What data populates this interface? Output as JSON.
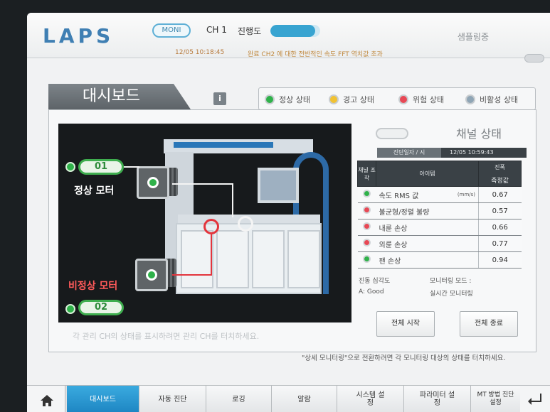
{
  "header": {
    "logo": "LAPS",
    "mode_badge": "MONI",
    "channel": "CH 1",
    "progress_label": "진행도",
    "progress_fraction": 0.9,
    "status": "샘플링중",
    "timestamp": "12/05  10:18:45",
    "notice": "완료 CH2 에 대한 전반적인 속도 FFT 역치값 초과"
  },
  "dashboard": {
    "title": "대시보드",
    "info_icon": "i"
  },
  "legend": [
    {
      "label": "정상 상태",
      "color": "#2fb24a"
    },
    {
      "label": "경고 상태",
      "color": "#f1c232"
    },
    {
      "label": "위험 상태",
      "color": "#e84855"
    },
    {
      "label": "비활성 상태",
      "color": "#8fa5b5"
    }
  ],
  "photo": {
    "ch1_label": "01",
    "ch2_label": "02",
    "normal_motor": "정상 모터",
    "abnormal_motor": "비정상 모터",
    "hint": "각 관리 CH의 상태를 표시하려면 관리 CH를 터치하세요."
  },
  "channel": {
    "title": "채널 상태",
    "diag_label": "진단일자 / 시",
    "diag_value": "12/05  10:59:43",
    "col_channel": "채널 조작",
    "col_item": "아이템",
    "col_value_top": "진폭",
    "col_value_bottom": "측정값",
    "rows": [
      {
        "item": "속도 RMS 값",
        "unit": "(mm/s)",
        "value": "0.67",
        "status": "green"
      },
      {
        "item": "불균형/정렬 불량",
        "unit": "",
        "value": "0.57",
        "status": "red"
      },
      {
        "item": "내륜 손상",
        "unit": "",
        "value": "0.66",
        "status": "red"
      },
      {
        "item": "외륜 손상",
        "unit": "",
        "value": "0.77",
        "status": "red"
      },
      {
        "item": "팬 손상",
        "unit": "",
        "value": "0.94",
        "status": "green"
      }
    ],
    "severity_label": "진동 심각도",
    "severity_value": "A: Good",
    "monitor_label": "모니터링 모드 :",
    "monitor_value": "실시간 모니터링",
    "start_all": "전체 시작",
    "stop_all": "전체 종료"
  },
  "bottom_hint": "\"상세 모니터링\"으로 전환하려면 각 모니터링 대상의 상태를 터치하세요.",
  "nav": {
    "home_icon": "home-icon",
    "items": [
      {
        "label": "대시보드",
        "active": true
      },
      {
        "label": "자동 진단",
        "active": false
      },
      {
        "label": "로깅",
        "active": false
      },
      {
        "label": "알람",
        "active": false
      },
      {
        "label": "시스템 설정",
        "active": false
      },
      {
        "label": "파라미터 설정",
        "active": false
      },
      {
        "label": "MT 방법 진단 설정",
        "active": false
      }
    ],
    "back_icon": "back-arrow-icon"
  }
}
